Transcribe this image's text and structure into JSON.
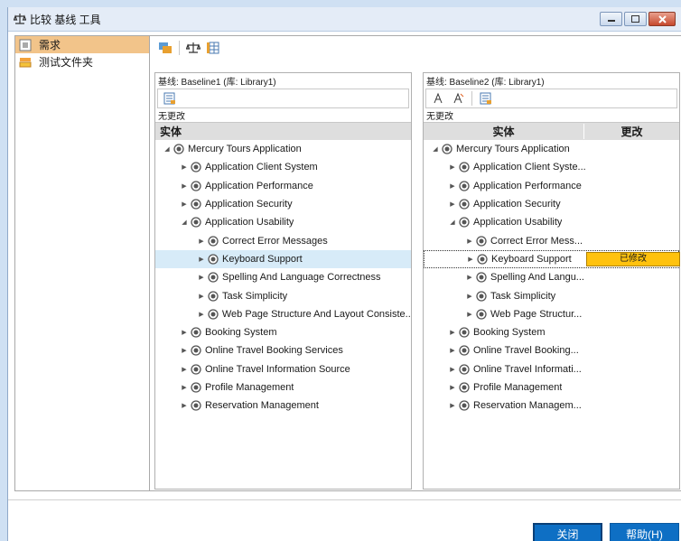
{
  "window": {
    "title": "比较 基线 工具"
  },
  "sidebar": {
    "items": [
      {
        "label": "需求",
        "icon": "requirements-icon",
        "selected": true
      },
      {
        "label": "测试文件夹",
        "icon": "test-folder-icon",
        "selected": false
      }
    ]
  },
  "left_panel": {
    "header": "基线: Baseline1 (库: Library1)",
    "status": "无更改",
    "column": "实体",
    "rows": [
      {
        "label": "Mercury Tours Application",
        "twisty": "open"
      },
      {
        "label": "Application Client System",
        "twisty": "closed"
      },
      {
        "label": "Application Performance",
        "twisty": "closed"
      },
      {
        "label": "Application Security",
        "twisty": "closed"
      },
      {
        "label": "Application Usability",
        "twisty": "open"
      },
      {
        "label": "Correct Error Messages",
        "twisty": "closed"
      },
      {
        "label": "Keyboard Support",
        "twisty": "closed"
      },
      {
        "label": "Spelling And Language Correctness",
        "twisty": "closed"
      },
      {
        "label": "Task Simplicity",
        "twisty": "closed"
      },
      {
        "label": "Web Page Structure And Layout Consiste...",
        "twisty": "closed"
      },
      {
        "label": "Booking System",
        "twisty": "closed"
      },
      {
        "label": "Online Travel Booking Services",
        "twisty": "closed"
      },
      {
        "label": "Online Travel Information Source",
        "twisty": "closed"
      },
      {
        "label": "Profile Management",
        "twisty": "closed"
      },
      {
        "label": "Reservation Management",
        "twisty": "closed"
      }
    ]
  },
  "right_panel": {
    "header": "基线: Baseline2 (库: Library1)",
    "status": "无更改",
    "columns": [
      "实体",
      "更改"
    ],
    "rows": [
      {
        "label": "Mercury Tours Application",
        "twisty": "open"
      },
      {
        "label": "Application Client Syste...",
        "twisty": "closed"
      },
      {
        "label": "Application Performance",
        "twisty": "closed"
      },
      {
        "label": "Application Security",
        "twisty": "closed"
      },
      {
        "label": "Application Usability",
        "twisty": "open"
      },
      {
        "label": "Correct Error Mess...",
        "twisty": "closed"
      },
      {
        "label": "Keyboard Support",
        "twisty": "closed",
        "change": "已修改"
      },
      {
        "label": "Spelling And Langu...",
        "twisty": "closed"
      },
      {
        "label": "Task Simplicity",
        "twisty": "closed"
      },
      {
        "label": "Web Page Structur...",
        "twisty": "closed"
      },
      {
        "label": "Booking System",
        "twisty": "closed"
      },
      {
        "label": "Online Travel Booking...",
        "twisty": "closed"
      },
      {
        "label": "Online Travel Informati...",
        "twisty": "closed"
      },
      {
        "label": "Profile Management",
        "twisty": "closed"
      },
      {
        "label": "Reservation Managem...",
        "twisty": "closed"
      }
    ]
  },
  "footer": {
    "close_label": "关闭",
    "help_label": "帮助(H)"
  },
  "colors": {
    "accent": "#0e6fc4",
    "selected_sidebar": "#f2c48a",
    "selected_row": "#d7ebf8",
    "modified_badge": "#ffc20e"
  }
}
